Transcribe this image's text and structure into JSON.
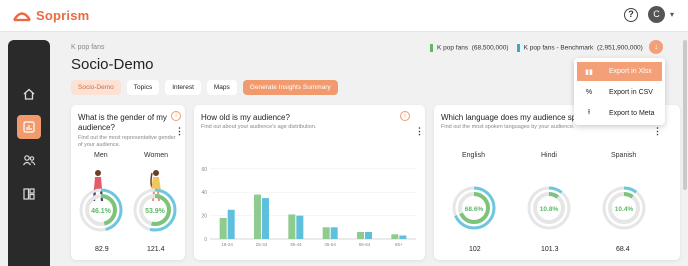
{
  "app": {
    "name": "Soprism",
    "brand_color": "#ea6a41",
    "accent": "#f19a6e"
  },
  "header": {
    "help_icon": "?",
    "avatar_initial": "C"
  },
  "sidebar": {
    "items": [
      "home-icon",
      "bar-chart-icon",
      "users-icon",
      "dashboard-icon"
    ]
  },
  "page": {
    "breadcrumb": "K pop fans",
    "title": "Socio-Demo",
    "legend": [
      {
        "label": "K pop fans",
        "value": "(68,500,000)",
        "color": "#5fb86a"
      },
      {
        "label": "K pop fans - Benchmark",
        "value": "(2,951,900,000)",
        "color": "#3aa8d4"
      }
    ]
  },
  "tabs": [
    {
      "label": "Socio-Demo",
      "active": true
    },
    {
      "label": "Topics"
    },
    {
      "label": "Interest"
    },
    {
      "label": "Maps"
    },
    {
      "label": "Generate Insights Summary"
    }
  ],
  "gender": {
    "title": "What is the gender of my audience?",
    "subtitle": "Find out the most representative gender of your audience.",
    "men": {
      "label": "Men",
      "pct": "46.1%",
      "fraction": 0.461,
      "value": "82.9"
    },
    "women": {
      "label": "Women",
      "pct": "53.9%",
      "fraction": 0.539,
      "value": "121.4"
    }
  },
  "age": {
    "title": "How old is my audience?",
    "subtitle": "Find out about your audience's age distribution."
  },
  "chart_data": {
    "type": "bar",
    "categories": [
      "18-24",
      "25-34",
      "35-44",
      "45-54",
      "55-64",
      "65+"
    ],
    "series": [
      {
        "name": "K pop fans",
        "values": [
          18,
          38,
          21,
          10,
          6,
          4
        ],
        "color": "#8fcb8f"
      },
      {
        "name": "K pop fans - Benchmark",
        "values": [
          25,
          35,
          20,
          10,
          6,
          3
        ],
        "color": "#5fc0dd"
      }
    ],
    "ylim": [
      0,
      65
    ],
    "yticks": [
      0,
      20,
      40,
      60
    ],
    "title": "",
    "xlabel": "",
    "ylabel": ""
  },
  "language": {
    "title": "Which language does my audience speak",
    "subtitle": "Find out the most spoken languages by your audience.",
    "items": [
      {
        "label": "English",
        "pct": "68.6%",
        "fraction": 0.686,
        "value": "102"
      },
      {
        "label": "Hindi",
        "pct": "10.8%",
        "fraction": 0.108,
        "value": "101.3"
      },
      {
        "label": "Spanish",
        "pct": "10.4%",
        "fraction": 0.104,
        "value": "68.4"
      }
    ]
  },
  "export_menu": [
    {
      "label": "Export in Xlsx",
      "icon": "bar-icon",
      "highlight": true
    },
    {
      "label": "Export in CSV",
      "icon": "percent-icon"
    },
    {
      "label": "Export to Meta",
      "icon": "upload-icon"
    }
  ]
}
